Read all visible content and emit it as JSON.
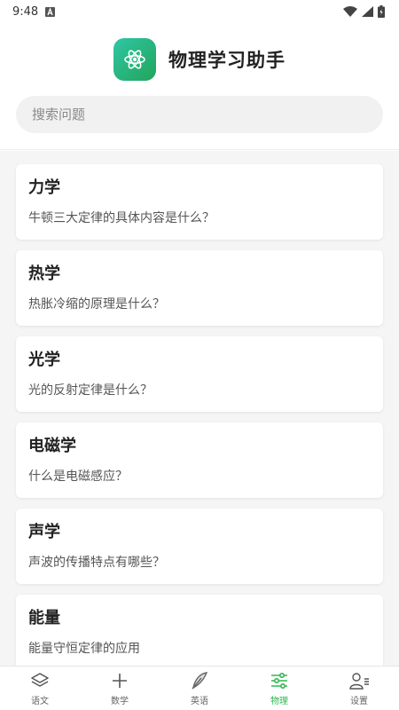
{
  "status_bar": {
    "time": "9:48"
  },
  "header": {
    "app_title": "物理学习助手"
  },
  "search": {
    "placeholder": "搜索问题"
  },
  "topics": [
    {
      "title": "力学",
      "question": "牛顿三大定律的具体内容是什么？"
    },
    {
      "title": "热学",
      "question": "热胀冷缩的原理是什么？"
    },
    {
      "title": "光学",
      "question": "光的反射定律是什么？"
    },
    {
      "title": "电磁学",
      "question": "什么是电磁感应？"
    },
    {
      "title": "声学",
      "question": "声波的传播特点有哪些？"
    },
    {
      "title": "能量",
      "question": "能量守恒定律的应用"
    }
  ],
  "tabs": [
    {
      "label": "语文",
      "icon": "layers-icon"
    },
    {
      "label": "数学",
      "icon": "plus-icon"
    },
    {
      "label": "英语",
      "icon": "feather-icon"
    },
    {
      "label": "物理",
      "icon": "sliders-icon",
      "active": true
    },
    {
      "label": "设置",
      "icon": "user-settings-icon"
    }
  ],
  "colors": {
    "accent": "#2eb84e",
    "logo_start": "#2fc7a4",
    "logo_end": "#22a45b"
  }
}
